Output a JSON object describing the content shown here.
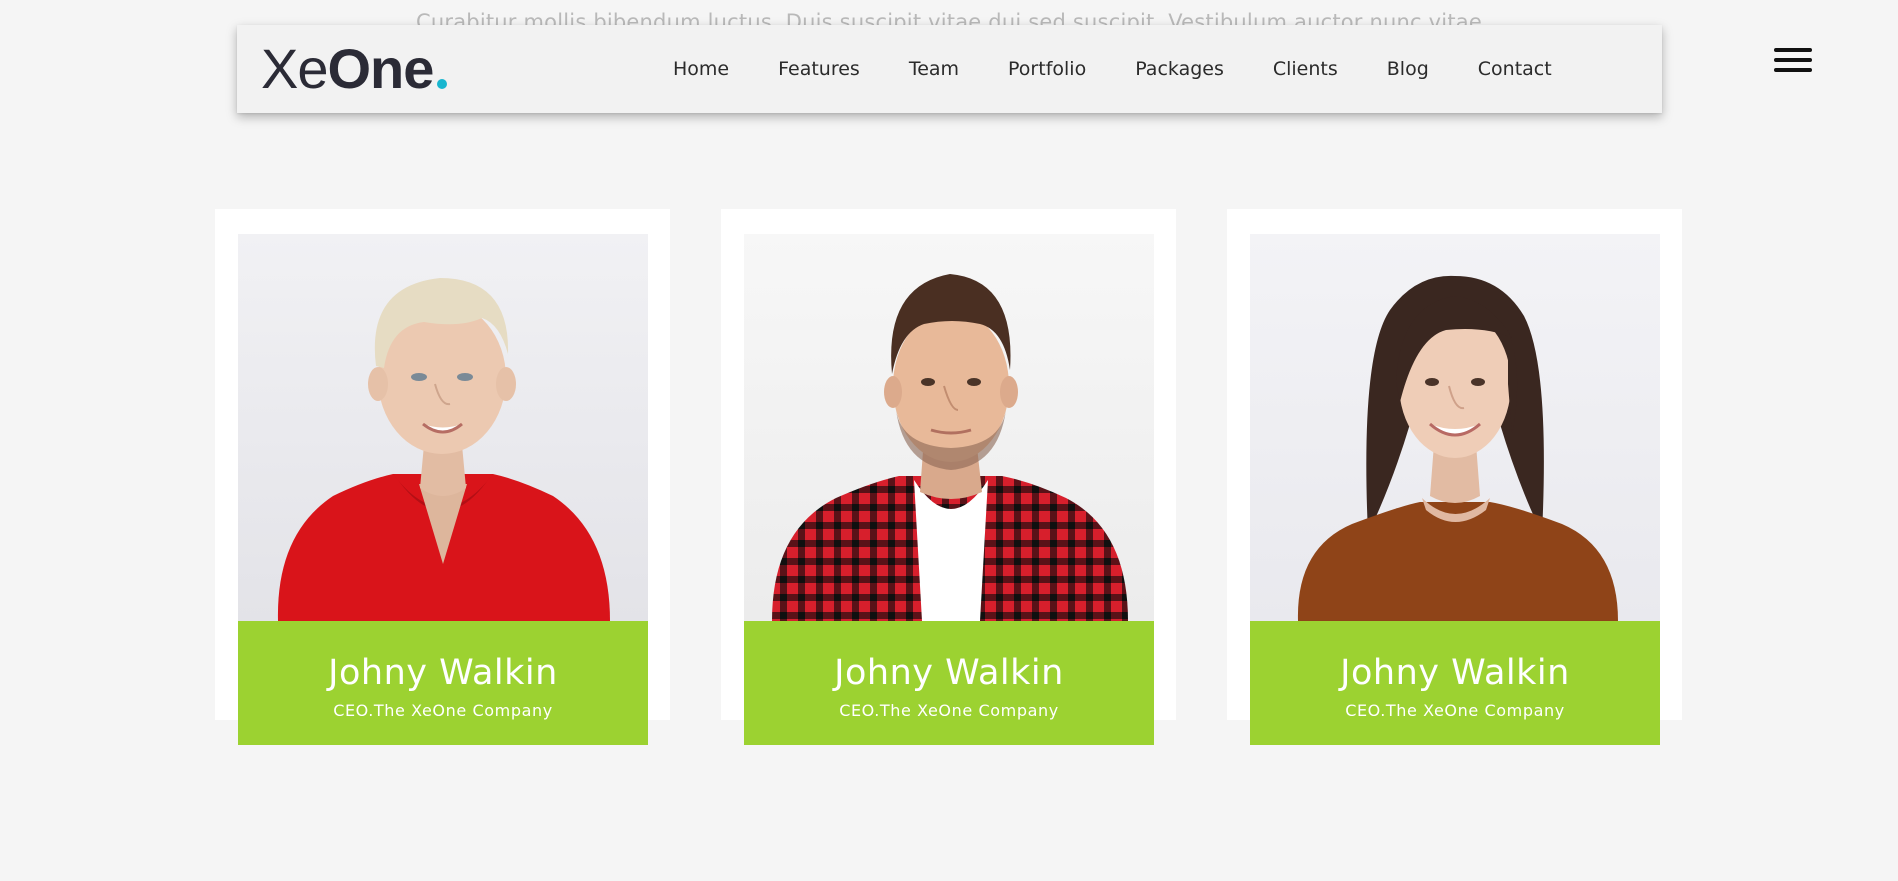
{
  "hero": {
    "background_text": "Curabitur mollis bibendum luctus. Duis suscipit vitae dui sed suscipit. Vestibulum auctor nunc vitae"
  },
  "brand": {
    "name_light": "Xe",
    "name_bold": "One",
    "dot_color": "#19b6cf"
  },
  "nav": {
    "items": [
      {
        "label": "Home"
      },
      {
        "label": "Features"
      },
      {
        "label": "Team"
      },
      {
        "label": "Portfolio"
      },
      {
        "label": "Packages"
      },
      {
        "label": "Clients"
      },
      {
        "label": "Blog"
      },
      {
        "label": "Contact"
      }
    ],
    "menu_icon": "hamburger-menu-icon"
  },
  "team": {
    "accent_color": "#9cd231",
    "members": [
      {
        "name": "Johny Walkin",
        "role": "CEO.The XeOne Company",
        "photo": "portrait-woman-short-blonde-red-blouse"
      },
      {
        "name": "Johny Walkin",
        "role": "CEO.The XeOne Company",
        "photo": "portrait-man-red-plaid-shirt"
      },
      {
        "name": "Johny Walkin",
        "role": "CEO.The XeOne Company",
        "photo": "portrait-woman-long-brown-hair-brown-sweater"
      }
    ]
  }
}
